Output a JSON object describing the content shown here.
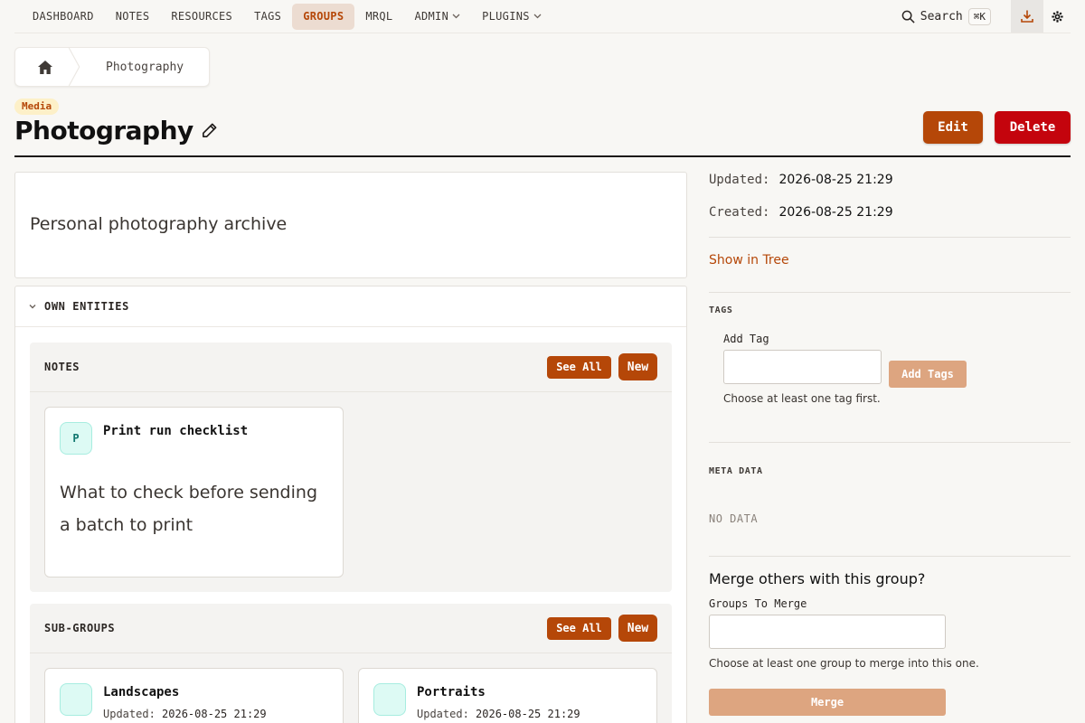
{
  "nav": {
    "items": [
      {
        "label": "DASHBOARD",
        "active": false,
        "dropdown": false
      },
      {
        "label": "NOTES",
        "active": false,
        "dropdown": false
      },
      {
        "label": "RESOURCES",
        "active": false,
        "dropdown": false
      },
      {
        "label": "TAGS",
        "active": false,
        "dropdown": false
      },
      {
        "label": "GROUPS",
        "active": true,
        "dropdown": false
      },
      {
        "label": "MRQL",
        "active": false,
        "dropdown": false
      },
      {
        "label": "ADMIN",
        "active": false,
        "dropdown": true
      },
      {
        "label": "PLUGINS",
        "active": false,
        "dropdown": true
      }
    ],
    "search_label": "Search",
    "search_shortcut": "⌘K",
    "download_icon": "download-icon",
    "settings_icon": "gear-icon"
  },
  "breadcrumb": {
    "home_icon": "home-icon",
    "current": "Photography"
  },
  "group": {
    "category_badge": "Media",
    "title": "Photography",
    "edit_label": "Edit",
    "delete_label": "Delete",
    "description": "Personal photography archive"
  },
  "own_entities": {
    "title": "OWN ENTITIES",
    "notes": {
      "title": "NOTES",
      "see_all_label": "See All",
      "new_label": "New",
      "items": [
        {
          "initial": "P",
          "title": "Print run checklist",
          "description": "What to check before sending a batch to print"
        }
      ]
    },
    "subgroups": {
      "title": "SUB-GROUPS",
      "see_all_label": "See All",
      "new_label": "New",
      "items": [
        {
          "title": "Landscapes",
          "updated_label": "Updated:",
          "updated": "2026-08-25 21:29"
        },
        {
          "title": "Portraits",
          "updated_label": "Updated:",
          "updated": "2026-08-25 21:29"
        }
      ]
    }
  },
  "sidebar": {
    "updated_label": "Updated:",
    "updated_value": "2026-08-25 21:29",
    "created_label": "Created:",
    "created_value": "2026-08-25 21:29",
    "show_in_tree": "Show in Tree",
    "tags": {
      "heading": "TAGS",
      "add_tag_label": "Add Tag",
      "add_tags_button": "Add Tags",
      "hint": "Choose at least one tag first."
    },
    "meta": {
      "heading": "META DATA",
      "empty": "NO DATA"
    },
    "merge": {
      "question": "Merge others with this group?",
      "field_label": "Groups To Merge",
      "hint": "Choose at least one group to merge into this one.",
      "button": "Merge"
    }
  },
  "colors": {
    "accent": "#b54708",
    "danger": "#c4040d",
    "active_nav_bg": "#ecdcd1",
    "badge_bg": "#fdf0c8"
  }
}
